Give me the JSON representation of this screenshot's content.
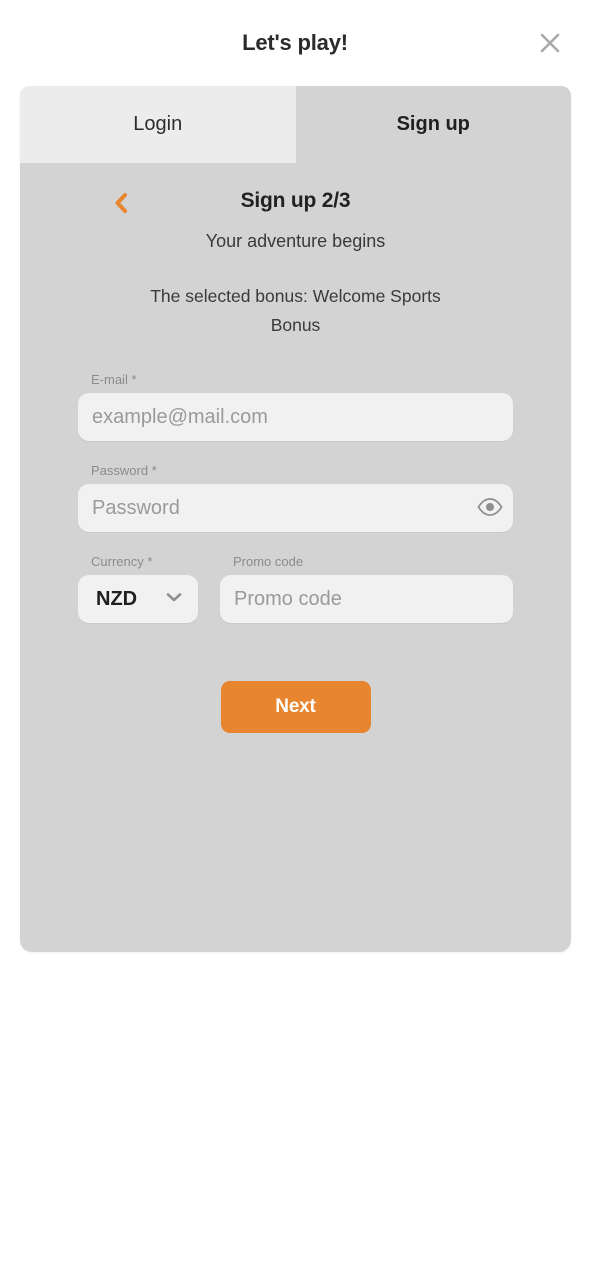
{
  "header": {
    "title": "Let's play!",
    "close_icon": "close-icon"
  },
  "tabs": [
    {
      "label": "Login",
      "active": false
    },
    {
      "label": "Sign up",
      "active": true
    }
  ],
  "step": {
    "back_icon": "chevron-left-icon",
    "title": "Sign up 2/3",
    "subtitle": "Your adventure begins",
    "bonus_note": "The selected bonus: Welcome Sports Bonus"
  },
  "form": {
    "email": {
      "label": "E-mail *",
      "placeholder": "example@mail.com",
      "value": ""
    },
    "password": {
      "label": "Password *",
      "placeholder": "Password",
      "value": "",
      "toggle_icon": "eye-icon"
    },
    "currency": {
      "label": "Currency *",
      "value": "NZD",
      "chevron_icon": "chevron-down-icon"
    },
    "promo": {
      "label": "Promo code",
      "placeholder": "Promo code",
      "value": ""
    },
    "submit_label": "Next"
  },
  "colors": {
    "accent": "#e8852f",
    "panel_bg": "#d3d3d4",
    "tab_inactive_bg": "#ececec",
    "input_bg": "#f1f1f2",
    "label_text": "#8b8b8d",
    "title_text": "#2b2b2b"
  }
}
